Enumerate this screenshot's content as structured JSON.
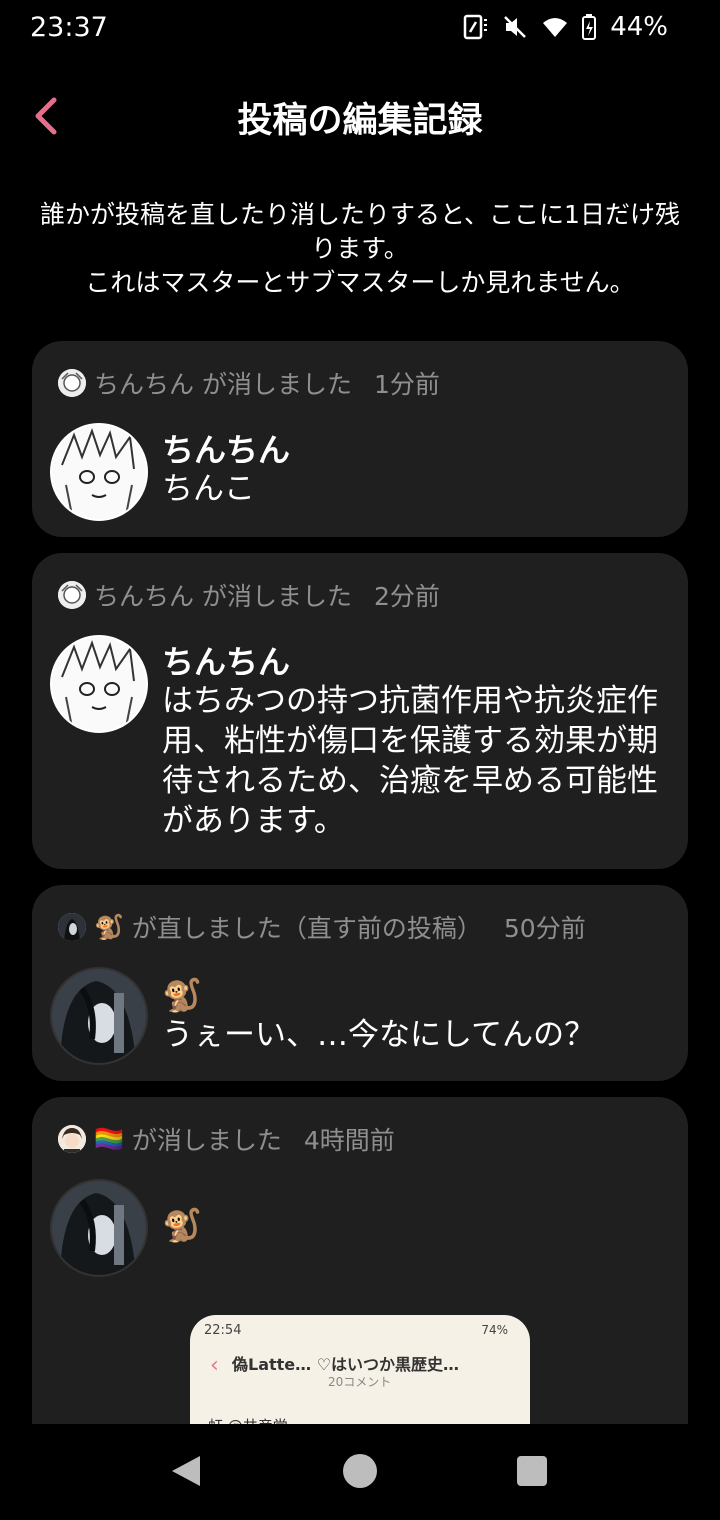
{
  "status_bar": {
    "time": "23:37",
    "battery": "44%",
    "icons": [
      "nfc-icon",
      "mute-icon",
      "wifi-icon",
      "battery-charging-icon"
    ]
  },
  "header": {
    "title": "投稿の編集記録",
    "back_icon": "chevron-left-icon",
    "accent_color": "#e36f8a"
  },
  "description": {
    "line1": "誰かが投稿を直したり消したりすると、ここに1日だけ残ります。",
    "line2": "これはマスターとサブマスターしか見れません。"
  },
  "records": [
    {
      "actor": "ちんちん",
      "action": "が消しました",
      "time": "1分前",
      "post_name": "ちんちん",
      "post_body": "ちんこ"
    },
    {
      "actor": "ちんちん",
      "action": "が消しました",
      "time": "2分前",
      "post_name": "ちんちん",
      "post_body": "はちみつの持つ抗菌作用や抗炎症作用、粘性が傷口を保護する効果が期待されるため、治癒を早める可能性があります。"
    },
    {
      "actor": "🐒",
      "action": "が直しました（直す前の投稿）",
      "time": "50分前",
      "post_name": "🐒",
      "post_body": "うぇーい、…今なにしてんの？"
    },
    {
      "actor": "🏳️‍🌈",
      "action": "が消しました",
      "time": "4時間前",
      "post_name": "🐒",
      "post_body": ""
    }
  ],
  "embedded_screenshot": {
    "time": "22:54",
    "battery": "74%",
    "title": "偽Latte… ♡はいつか黒歴史…",
    "subtitle": "20コメント",
    "row_text": "虹 @共産党"
  }
}
